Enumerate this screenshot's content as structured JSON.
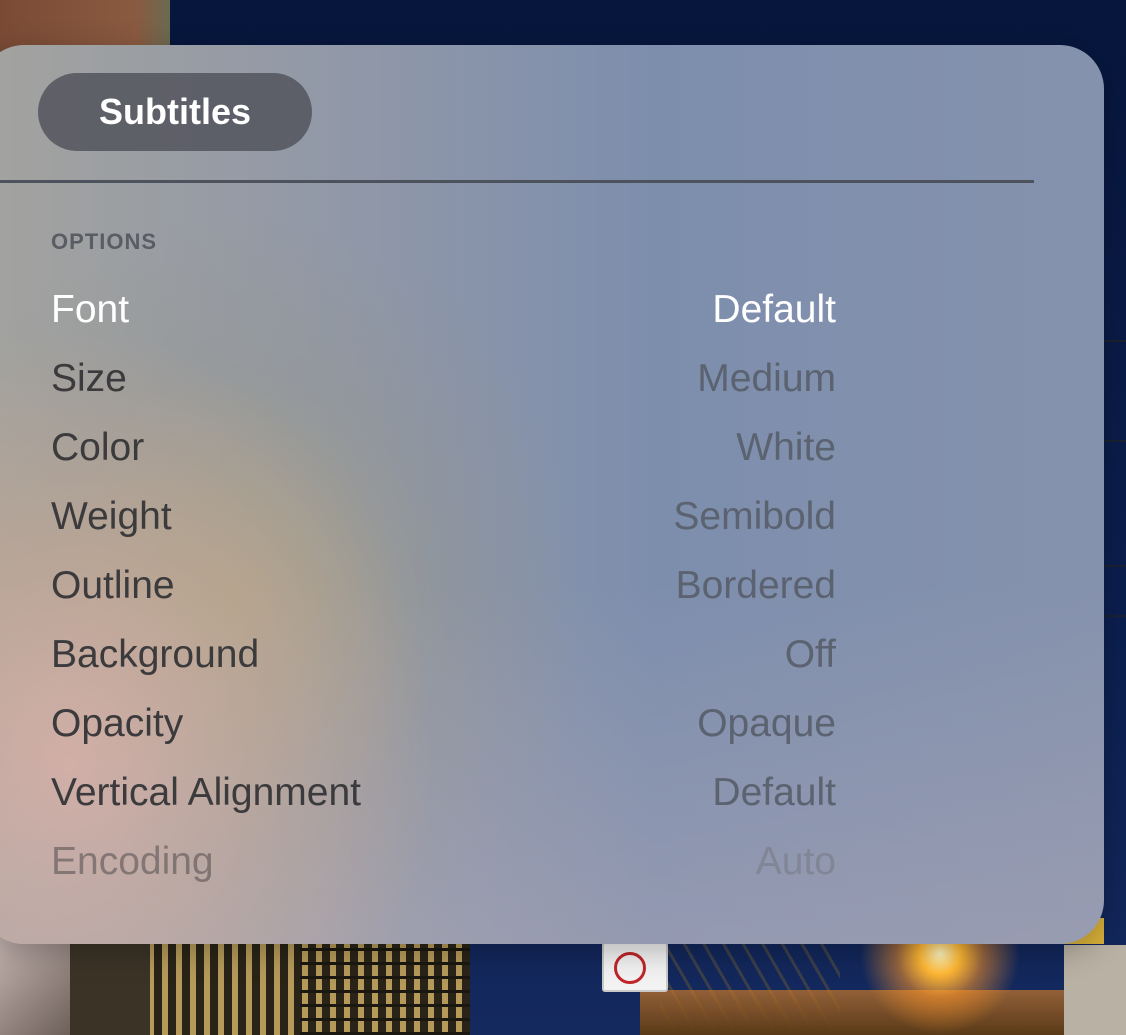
{
  "tab": {
    "label": "Subtitles"
  },
  "section": {
    "header": "OPTIONS"
  },
  "options": [
    {
      "label": "Font",
      "value": "Default"
    },
    {
      "label": "Size",
      "value": "Medium"
    },
    {
      "label": "Color",
      "value": "White"
    },
    {
      "label": "Weight",
      "value": "Semibold"
    },
    {
      "label": "Outline",
      "value": "Bordered"
    },
    {
      "label": "Background",
      "value": "Off"
    },
    {
      "label": "Opacity",
      "value": "Opaque"
    },
    {
      "label": "Vertical Alignment",
      "value": "Default"
    },
    {
      "label": "Encoding",
      "value": "Auto"
    }
  ],
  "focused_option": "Font",
  "colors": {
    "panel_tint": "#7d8ead",
    "tab_pill": "#50525a",
    "focused_text": "#ffffff",
    "label_text": "#3b3a3c",
    "value_text": "#5b6270"
  }
}
